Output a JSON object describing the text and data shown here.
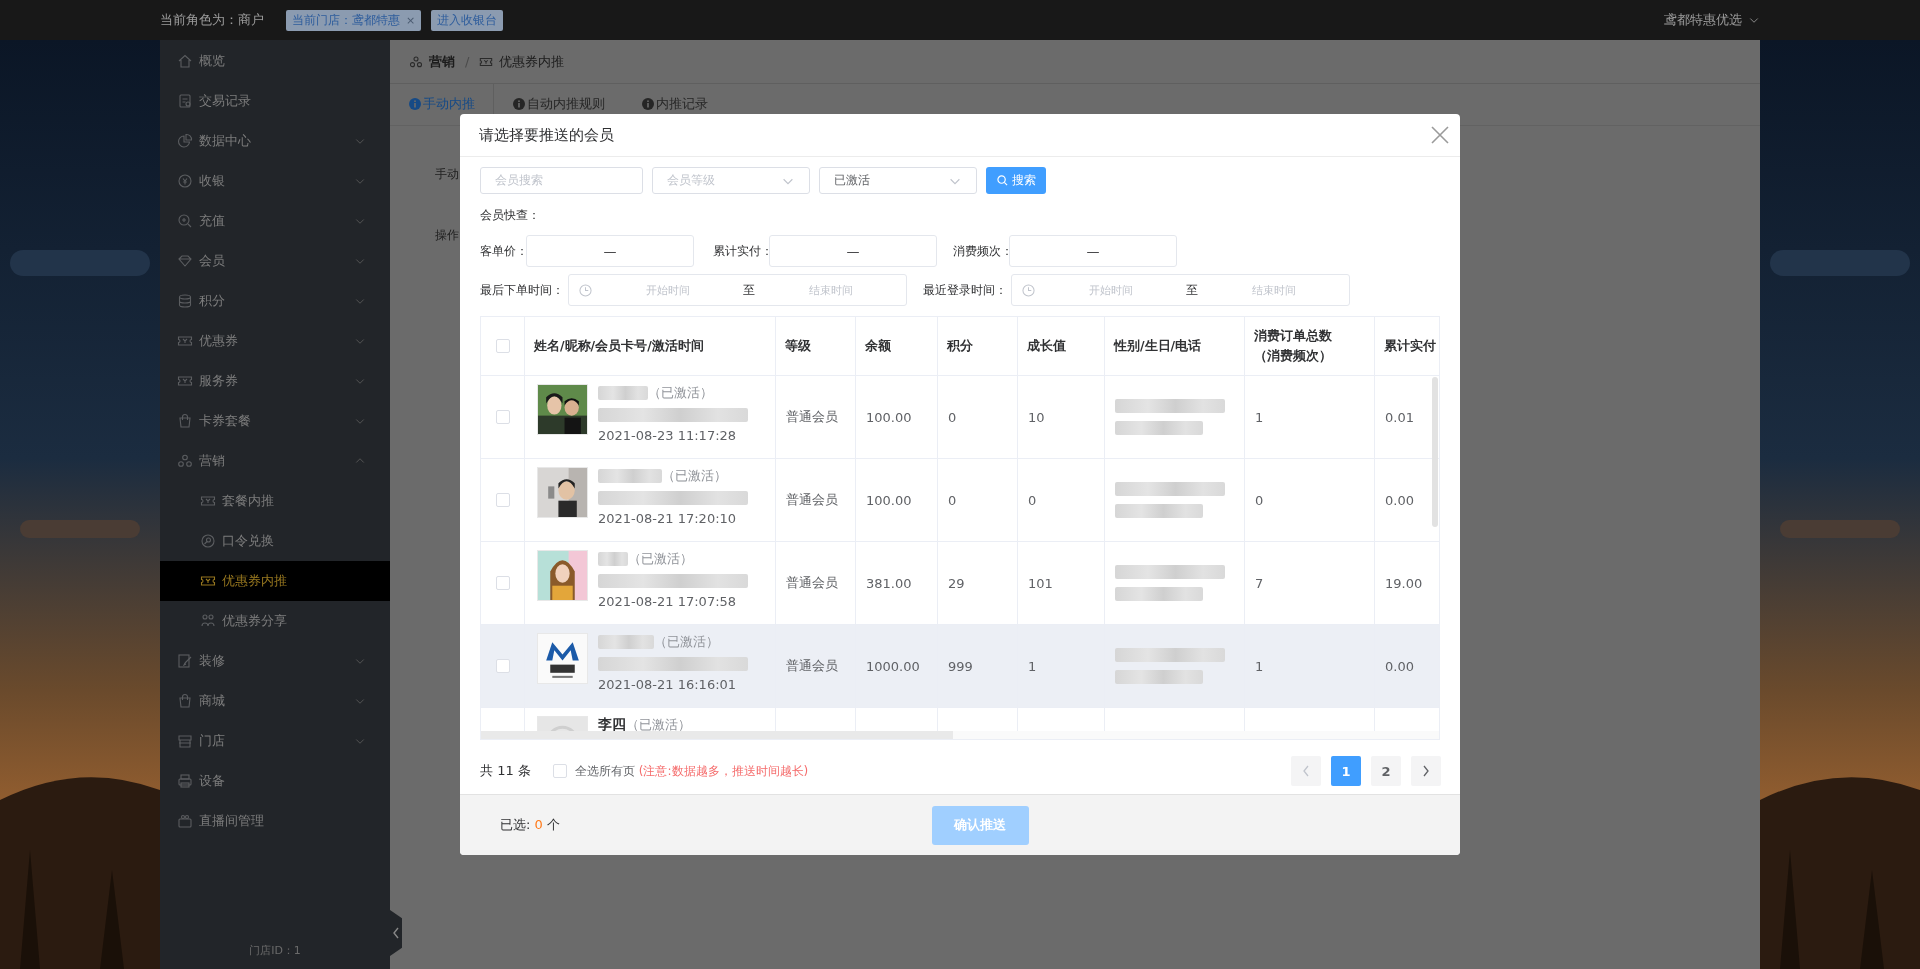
{
  "topbar": {
    "role": "当前角色为：商户",
    "tags": [
      {
        "label": "当前门店：鸢都特惠",
        "close": "×"
      },
      {
        "label": "进入收银台"
      }
    ],
    "user": "鸢都特惠优选"
  },
  "sidebar": {
    "items": [
      {
        "label": "概览",
        "kind": "link"
      },
      {
        "label": "交易记录",
        "kind": "link"
      },
      {
        "label": "数据中心",
        "kind": "group",
        "expanded": false
      },
      {
        "label": "收银",
        "kind": "group",
        "expanded": false
      },
      {
        "label": "充值",
        "kind": "group",
        "expanded": false
      },
      {
        "label": "会员",
        "kind": "group",
        "expanded": false
      },
      {
        "label": "积分",
        "kind": "group",
        "expanded": false
      },
      {
        "label": "优惠券",
        "kind": "group",
        "expanded": false
      },
      {
        "label": "服务券",
        "kind": "group",
        "expanded": false
      },
      {
        "label": "卡券套餐",
        "kind": "group",
        "expanded": false
      },
      {
        "label": "营销",
        "kind": "group",
        "expanded": true,
        "children": [
          {
            "label": "套餐内推",
            "selected": false
          },
          {
            "label": "口令兑换",
            "selected": false
          },
          {
            "label": "优惠券内推",
            "selected": true
          },
          {
            "label": "优惠券分享",
            "selected": false
          }
        ]
      },
      {
        "label": "装修",
        "kind": "group",
        "expanded": false
      },
      {
        "label": "商城",
        "kind": "group",
        "expanded": false
      },
      {
        "label": "门店",
        "kind": "group",
        "expanded": false
      },
      {
        "label": "设备",
        "kind": "link"
      },
      {
        "label": "直播间管理",
        "kind": "link"
      }
    ],
    "footer": "门店ID：1"
  },
  "main": {
    "breadcrumb": [
      "营销",
      "优惠券内推"
    ],
    "breadcrumb_separator": "/",
    "tabs": [
      {
        "label": "手动内推",
        "selected": true
      },
      {
        "label": "自动内推规则",
        "selected": false
      },
      {
        "label": "内推记录",
        "selected": false
      }
    ],
    "form_labels": [
      "手动",
      "操作"
    ]
  },
  "modal": {
    "title": "请选择要推送的会员",
    "filters": {
      "search_placeholder": "会员搜索",
      "level_placeholder": "会员等级",
      "status_value": "已激活",
      "search_button": "搜索"
    },
    "quick_label": "会员快查：",
    "ranges": [
      {
        "label": "客单价：",
        "separator": "—"
      },
      {
        "label": "累计实付：",
        "separator": "—"
      },
      {
        "label": "消费频次：",
        "separator": "—"
      }
    ],
    "date_ranges": [
      {
        "label": "最后下单时间：",
        "start_placeholder": "开始时间",
        "separator": "至",
        "end_placeholder": "结束时间"
      },
      {
        "label": "最近登录时间：",
        "start_placeholder": "开始时间",
        "separator": "至",
        "end_placeholder": "结束时间"
      }
    ],
    "table": {
      "all_checked": false,
      "columns": [
        "姓名/昵称/会员卡号/激活时间",
        "等级",
        "余额",
        "积分",
        "成长值",
        "性别/生日/电话",
        "消费订单总数（消费频次）",
        "累计实付"
      ],
      "rows": [
        {
          "checked": false,
          "hovered": false,
          "status": "（已激活）",
          "activated": "2021-08-23 11:17:28",
          "level": "普通会员",
          "balance": "100.00",
          "points": "0",
          "growth": "10",
          "orders": "1",
          "paid": "0.01"
        },
        {
          "checked": false,
          "hovered": false,
          "status": "（已激活）",
          "activated": "2021-08-21 17:20:10",
          "level": "普通会员",
          "balance": "100.00",
          "points": "0",
          "growth": "0",
          "orders": "0",
          "paid": "0.00"
        },
        {
          "checked": false,
          "hovered": false,
          "status": "（已激活）",
          "activated": "2021-08-21 17:07:58",
          "level": "普通会员",
          "balance": "381.00",
          "points": "29",
          "growth": "101",
          "orders": "7",
          "paid": "19.00"
        },
        {
          "checked": false,
          "hovered": true,
          "status": "（已激活）",
          "activated": "2021-08-21 16:16:01",
          "level": "普通会员",
          "balance": "1000.00",
          "points": "999",
          "growth": "1",
          "orders": "1",
          "paid": "0.00"
        },
        {
          "name": "李四",
          "status": "（已激活）"
        }
      ]
    },
    "total": "共 11 条",
    "select_all": {
      "label": "全选所有页",
      "checked": false
    },
    "warning": "(注意:数据越多，推送时间越长)",
    "pagination": {
      "prev_disabled": true,
      "next_disabled": false,
      "pages": [
        {
          "label": "1",
          "selected": true
        },
        {
          "label": "2",
          "selected": false
        }
      ]
    },
    "footer": {
      "selected_label": "已选:",
      "selected_count": "0",
      "unit": "个",
      "confirm": "确认推送",
      "confirm_disabled": true
    }
  }
}
